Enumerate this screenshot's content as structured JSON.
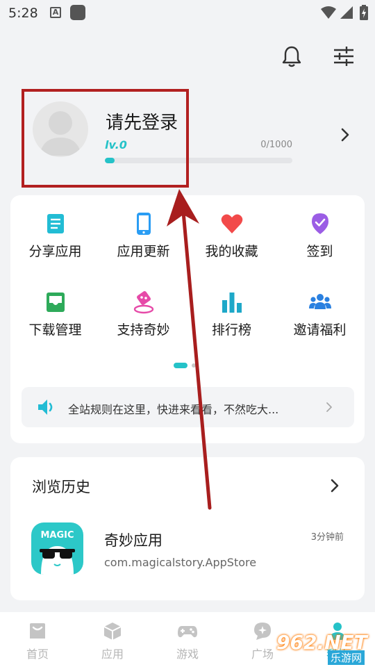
{
  "status_bar": {
    "time": "5:28",
    "notification_badge": "A"
  },
  "profile": {
    "title": "请先登录",
    "level": "lv.0",
    "exp_text": "0/1000",
    "progress_fraction": 0.05
  },
  "quick_actions": [
    {
      "label": "分享应用",
      "icon": "document-icon",
      "color": "#22bcd4"
    },
    {
      "label": "应用更新",
      "icon": "phone-icon",
      "color": "#2a9df4"
    },
    {
      "label": "我的收藏",
      "icon": "heart-icon",
      "color": "#f24a4a"
    },
    {
      "label": "签到",
      "icon": "checkin-badge-icon",
      "color": "#9b5de5"
    },
    {
      "label": "下载管理",
      "icon": "download-tray-icon",
      "color": "#2eaa5a"
    },
    {
      "label": "支持奇妙",
      "icon": "support-badge-icon",
      "color": "#e64aa8"
    },
    {
      "label": "排行榜",
      "icon": "bar-chart-icon",
      "color": "#1ea8c8"
    },
    {
      "label": "邀请福利",
      "icon": "group-icon",
      "color": "#2a80e0"
    }
  ],
  "notice": {
    "text": "全站规则在这里，快进来看看，不然吃大..."
  },
  "history": {
    "title": "浏览历史",
    "items": [
      {
        "name": "奇妙应用",
        "package": "com.magicalstory.AppStore",
        "time": "3分钟前",
        "icon_text": "MAGIC"
      }
    ]
  },
  "tabs": [
    {
      "label": "首页",
      "icon": "home-icon"
    },
    {
      "label": "应用",
      "icon": "cube-icon"
    },
    {
      "label": "游戏",
      "icon": "gamepad-icon"
    },
    {
      "label": "广场",
      "icon": "chat-icon"
    },
    {
      "label": "我的",
      "icon": "person-icon"
    }
  ],
  "watermark": {
    "brand": "962.NET",
    "sub": "乐游网"
  },
  "colors": {
    "accent": "#25c2c8",
    "annotation_red": "#b22020"
  }
}
